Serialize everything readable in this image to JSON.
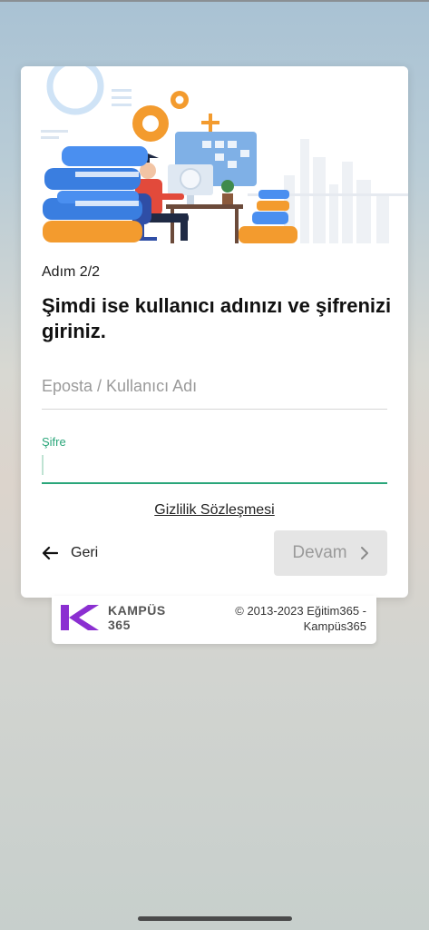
{
  "step": {
    "label": "Adım 2/2"
  },
  "title": "Şimdi ise kullanıcı adınızı ve şifrenizi giriniz.",
  "username_field": {
    "placeholder": "Eposta / Kullanıcı Adı",
    "value": ""
  },
  "password_field": {
    "label": "Şifre",
    "value": ""
  },
  "privacy_link": "Gizlilik Sözleşmesi",
  "back_button": {
    "label": "Geri",
    "icon": "arrow-left-icon"
  },
  "continue_button": {
    "label": "Devam",
    "icon": "chevron-right-icon"
  },
  "footer": {
    "logo_text": "KAMPÜS 365",
    "copyright": "© 2013-2023 Eğitim365 - Kampüs365"
  },
  "colors": {
    "accent_green": "#2aa67a",
    "brand_purple": "#8b2fd1",
    "button_disabled_bg": "#e5e5e5"
  }
}
